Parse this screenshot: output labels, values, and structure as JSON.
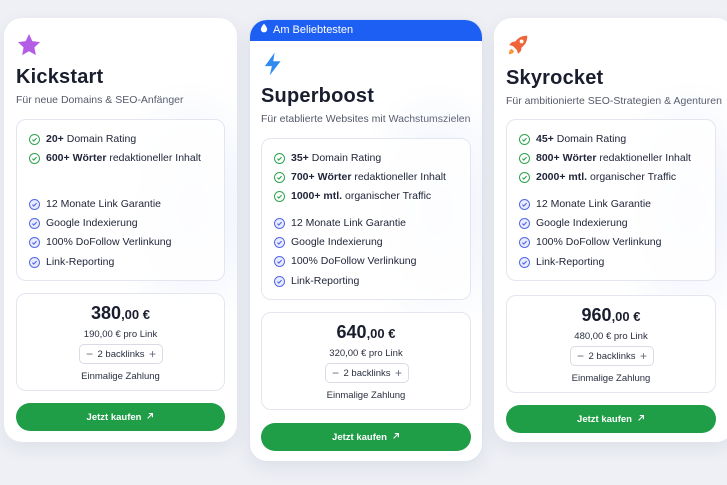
{
  "colors": {
    "accent_blue": "#1d5ff2",
    "buy_green": "#1f9d47",
    "check_green": "#2ea44f",
    "check_blue": "#5468e8"
  },
  "badge": {
    "label": "Am Beliebtesten",
    "icon": "drop-icon"
  },
  "plans": [
    {
      "icon": "star-icon",
      "name": "Kickstart",
      "subtitle": "Für neue Domains & SEO-Anfänger",
      "features_primary": [
        {
          "bold": "20+",
          "text": " Domain Rating"
        },
        {
          "bold": "600+ Wörter",
          "text": " redaktioneller Inhalt"
        }
      ],
      "features_secondary": [
        "12 Monate Link Garantie",
        "Google Indexierung",
        "100% DoFollow Verlinkung",
        "Link-Reporting"
      ],
      "price_main": "380",
      "price_dec": ",00 €",
      "per_link": "190,00 € pro Link",
      "stepper": {
        "minus": "−",
        "value": "2 backlinks",
        "plus": "+"
      },
      "payment": "Einmalige Zahlung",
      "button": "Jetzt kaufen",
      "button_icon": "arrow-up-right-icon"
    },
    {
      "icon": "lightning-icon",
      "name": "Superboost",
      "subtitle": "Für etablierte Websites mit Wachstumszielen",
      "features_primary": [
        {
          "bold": "35+",
          "text": " Domain Rating"
        },
        {
          "bold": "700+ Wörter",
          "text": " redaktioneller Inhalt"
        },
        {
          "bold": "1000+ mtl.",
          "text": " organischer Traffic"
        }
      ],
      "features_secondary": [
        "12 Monate Link Garantie",
        "Google Indexierung",
        "100% DoFollow Verlinkung",
        "Link-Reporting"
      ],
      "price_main": "640",
      "price_dec": ",00 €",
      "per_link": "320,00 € pro Link",
      "stepper": {
        "minus": "−",
        "value": "2 backlinks",
        "plus": "+"
      },
      "payment": "Einmalige Zahlung",
      "button": "Jetzt kaufen",
      "button_icon": "arrow-up-right-icon"
    },
    {
      "icon": "rocket-icon",
      "name": "Skyrocket",
      "subtitle": "Für ambitionierte SEO-Strategien & Agenturen",
      "features_primary": [
        {
          "bold": "45+",
          "text": " Domain Rating"
        },
        {
          "bold": "800+ Wörter",
          "text": " redaktioneller Inhalt"
        },
        {
          "bold": "2000+ mtl.",
          "text": " organischer Traffic"
        }
      ],
      "features_secondary": [
        "12 Monate Link Garantie",
        "Google Indexierung",
        "100% DoFollow Verlinkung",
        "Link-Reporting"
      ],
      "price_main": "960",
      "price_dec": ",00 €",
      "per_link": "480,00 € pro Link",
      "stepper": {
        "minus": "−",
        "value": "2 backlinks",
        "plus": "+"
      },
      "payment": "Einmalige Zahlung",
      "button": "Jetzt kaufen",
      "button_icon": "arrow-up-right-icon"
    }
  ]
}
